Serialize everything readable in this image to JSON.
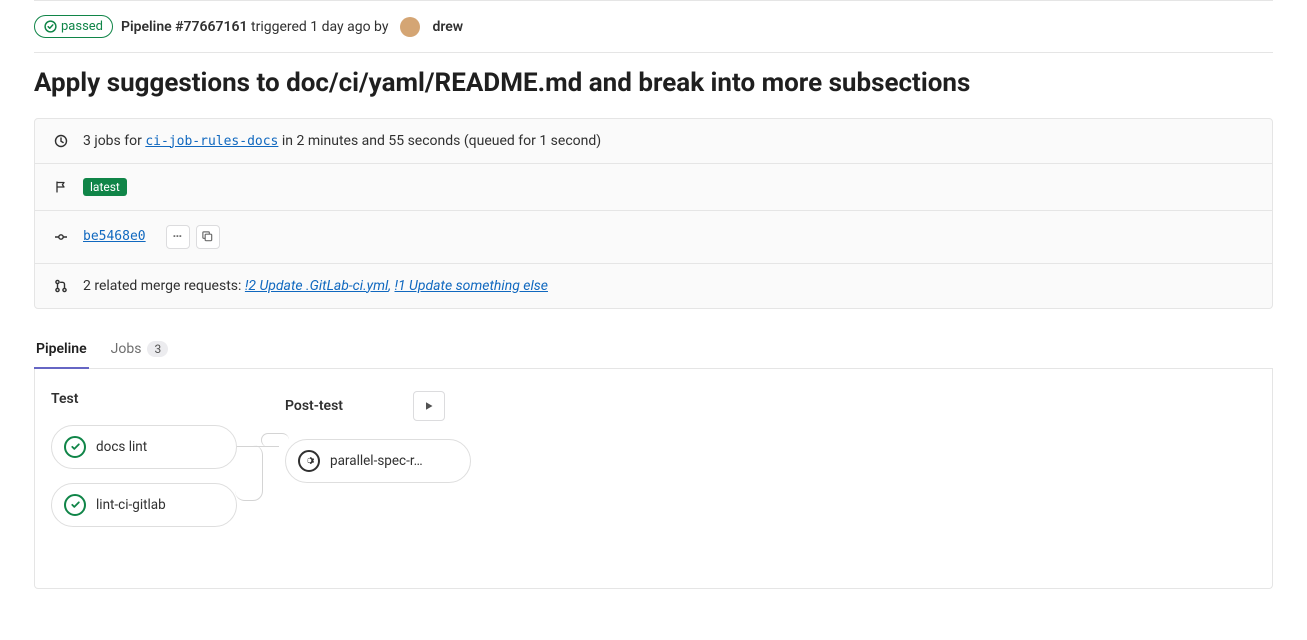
{
  "status": {
    "label": "passed"
  },
  "pipeline": {
    "label_prefix": "Pipeline",
    "number": "#77667161",
    "triggered_text": "triggered 1 day ago by",
    "author": "drew"
  },
  "title": "Apply suggestions to doc/ci/yaml/README.md and break into more subsections",
  "jobs_summary": {
    "prefix": "3 jobs for",
    "branch": "ci-job-rules-docs",
    "suffix": "in 2 minutes and 55 seconds (queued for 1 second)"
  },
  "tags": {
    "latest": "latest"
  },
  "commit": {
    "sha": "be5468e0"
  },
  "related_mrs": {
    "prefix": "2 related merge requests:",
    "items": [
      {
        "text": "!2 Update .GitLab-ci.yml"
      },
      {
        "text": "!1 Update something else"
      }
    ],
    "separator": ","
  },
  "tabs": {
    "pipeline": "Pipeline",
    "jobs": "Jobs",
    "jobs_count": "3"
  },
  "stages": {
    "test": {
      "title": "Test",
      "jobs": [
        {
          "name": "docs lint"
        },
        {
          "name": "lint-ci-gitlab"
        }
      ]
    },
    "post_test": {
      "title": "Post-test",
      "jobs": [
        {
          "name": "parallel-spec-r…"
        }
      ]
    }
  }
}
